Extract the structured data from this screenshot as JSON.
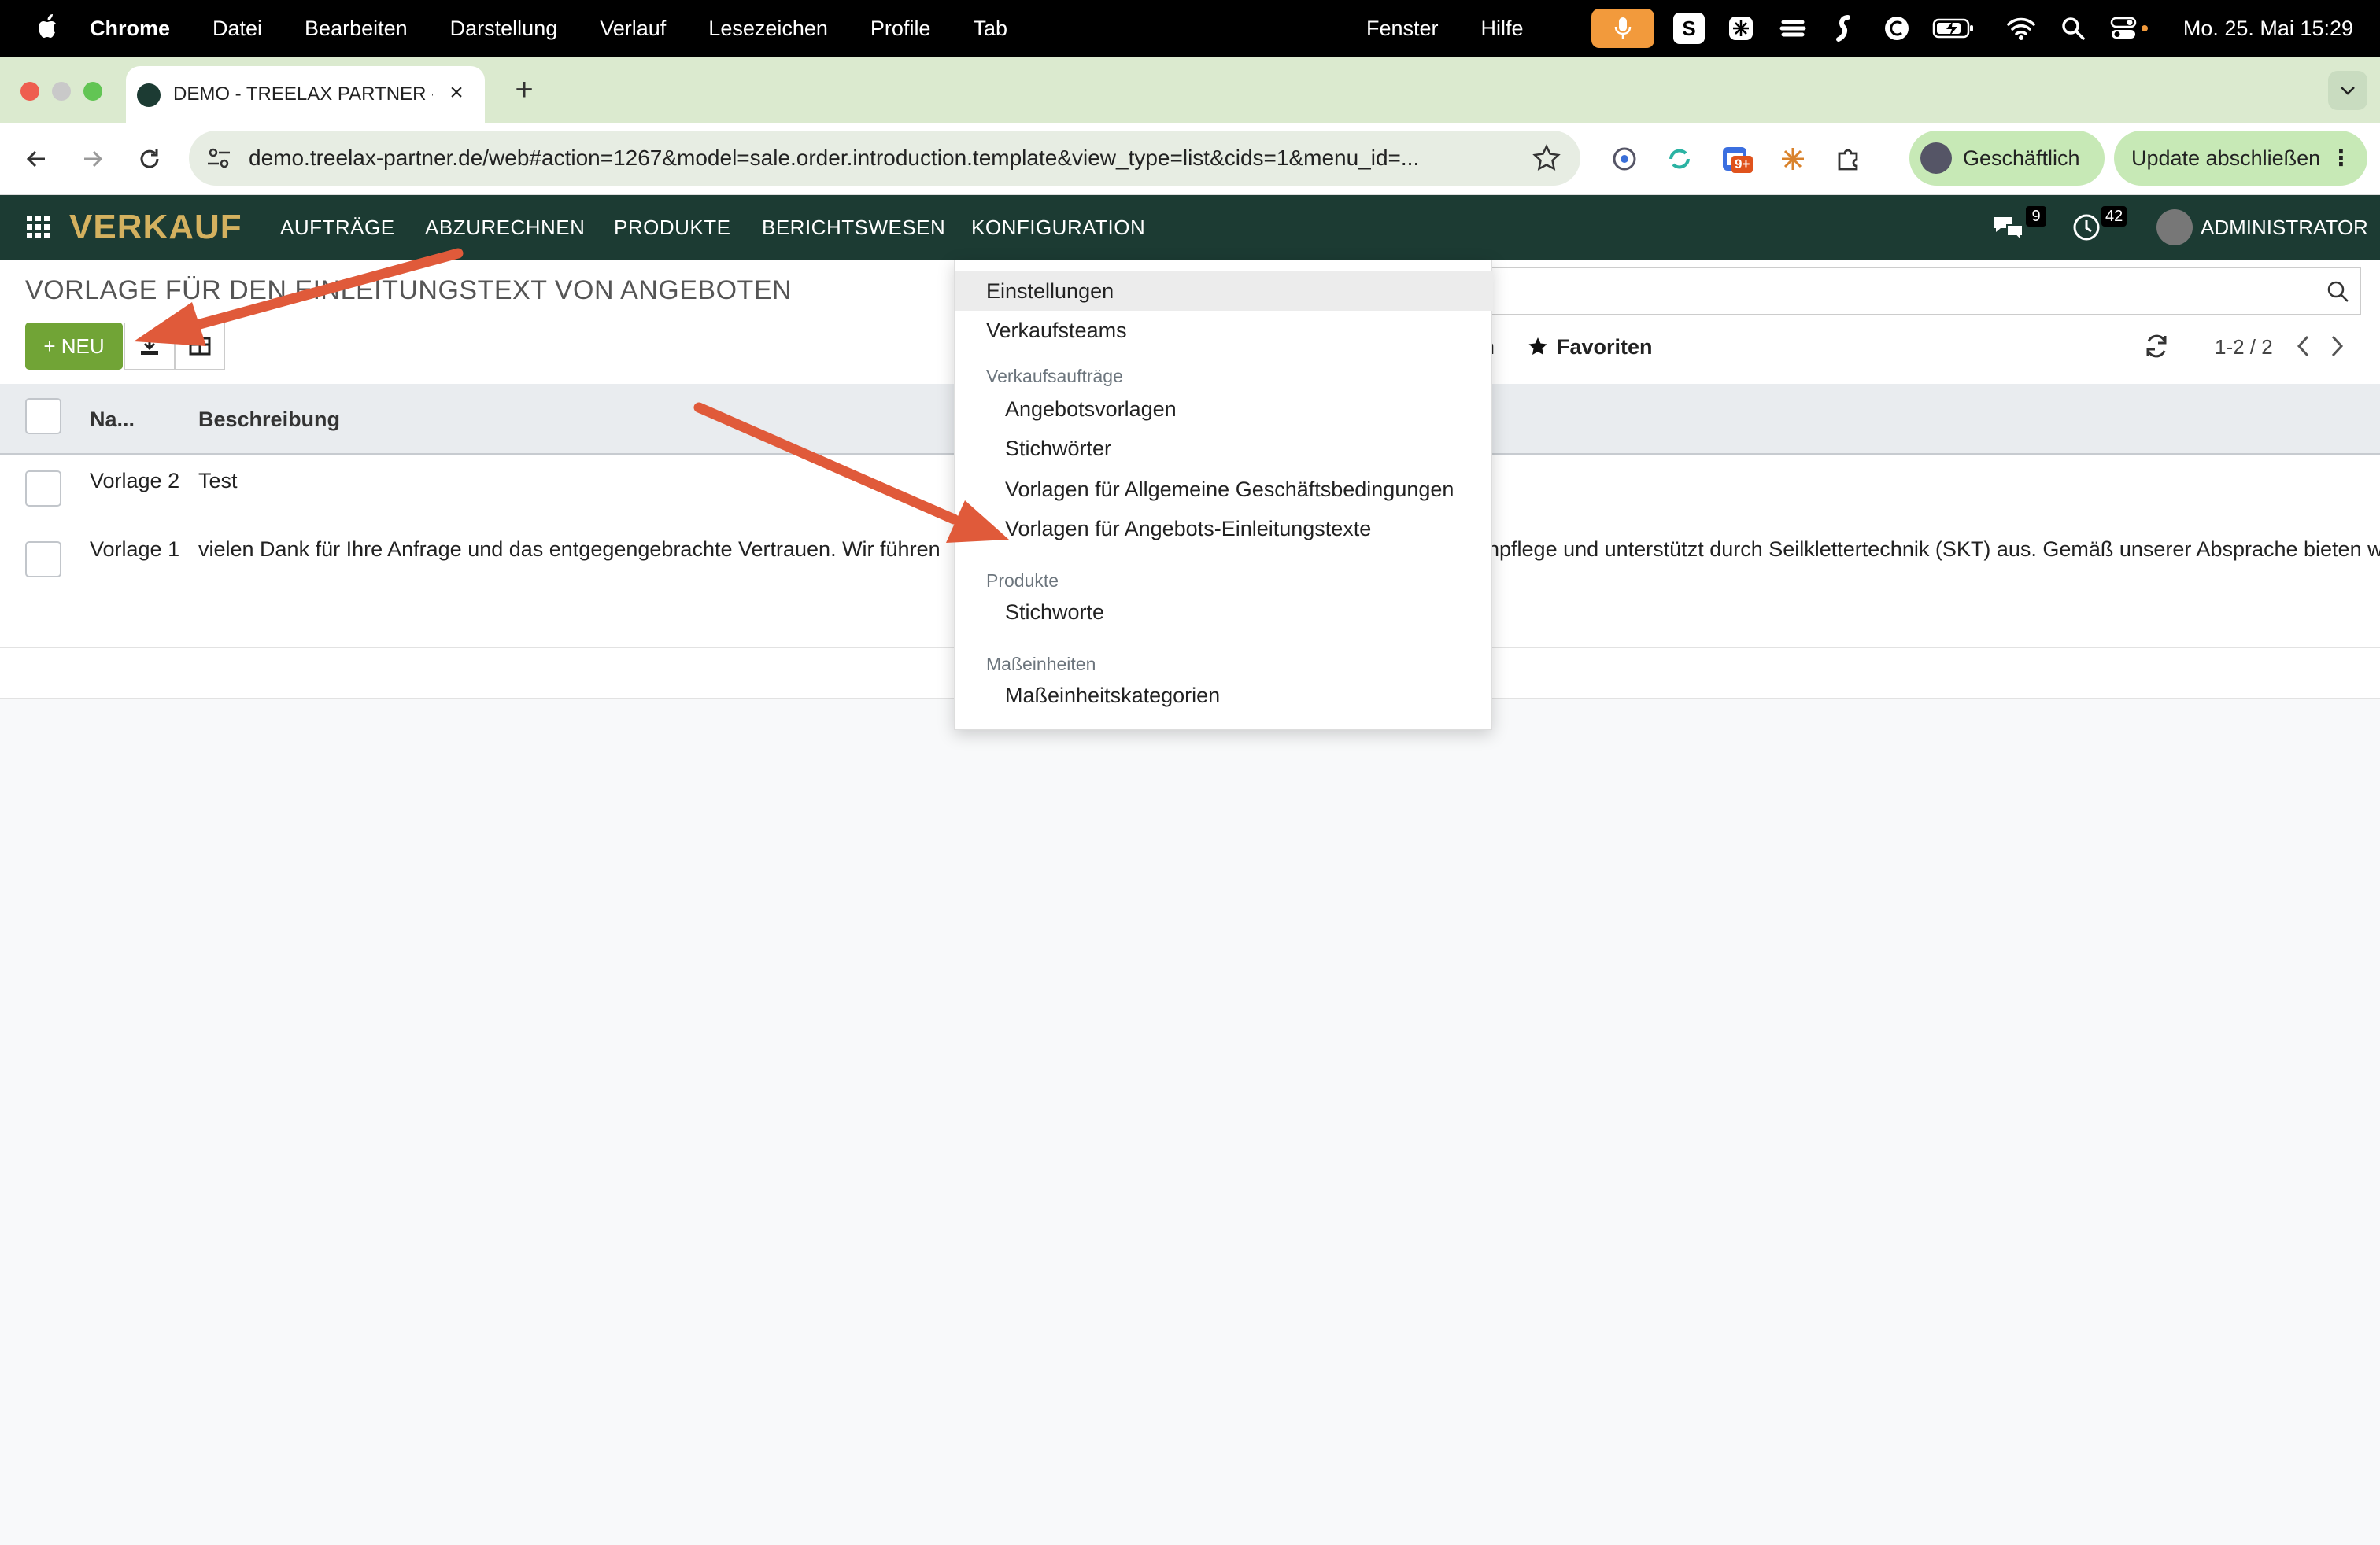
{
  "macos": {
    "app_name": "Chrome",
    "menus": [
      "Datei",
      "Bearbeiten",
      "Darstellung",
      "Verlauf",
      "Lesezeichen",
      "Profile",
      "Tab"
    ],
    "menus_right": [
      "Fenster",
      "Hilfe"
    ],
    "status_icons": [
      "microphone-icon",
      "s-app-icon",
      "perplexity-icon",
      "stacks-icon",
      "flow-icon",
      "c-circle-icon",
      "battery-icon",
      "wifi-icon",
      "spotlight-icon",
      "control-center-icon"
    ],
    "s_label": "S",
    "clock": "Mo. 25. Mai  15:29"
  },
  "browser": {
    "tab_title": "DEMO - TREELAX PARTNER -",
    "url": "demo.treelax-partner.de/web#action=1267&model=sale.order.introduction.template&view_type=list&cids=1&menu_id=...",
    "extension_badge": "9+",
    "profile_label": "Geschäftlich",
    "update_label": "Update abschließen",
    "update_more": "⋮"
  },
  "odoo_nav": {
    "brand": "VERKAUF",
    "items": [
      "AUFTRÄGE",
      "ABZURECHNEN",
      "PRODUKTE",
      "BERICHTSWESEN",
      "KONFIGURATION"
    ],
    "messages_count": "9",
    "activities_count": "42",
    "user": "ADMINISTRATOR"
  },
  "control_panel": {
    "title": "VORLAGE FÜR DEN EINLEITUNGSTEXT VON ANGEBOTEN",
    "new_button": "+ NEU",
    "partial_label": "n",
    "favorites": "Favoriten",
    "pager": "1-2 / 2"
  },
  "table": {
    "headers": [
      "Na...",
      "Beschreibung"
    ],
    "rows": [
      {
        "name": "Vorlage 2",
        "description_left": "Test",
        "description_right": ""
      },
      {
        "name": "Vorlage 1",
        "description_left": "vielen Dank für Ihre Anfrage und das entgegengebrachte Vertrauen. Wir führen",
        "description_right": "npflege und unterstützt durch Seilklettertechnik (SKT) aus. Gemäß unserer Absprache bieten w"
      }
    ]
  },
  "dropdown": {
    "top_items": [
      "Einstellungen",
      "Verkaufsteams"
    ],
    "sections": [
      {
        "header": "Verkaufsaufträge",
        "items": [
          "Angebotsvorlagen",
          "Stichwörter",
          "Vorlagen für Allgemeine Geschäftsbedingungen",
          "Vorlagen für Angebots-Einleitungstexte"
        ]
      },
      {
        "header": "Produkte",
        "items": [
          "Stichworte"
        ]
      },
      {
        "header": "Maßeinheiten",
        "items": [
          "Maßeinheitskategorien"
        ]
      }
    ]
  },
  "colors": {
    "odoo_nav_bg": "#1c3b33",
    "brand": "#d4b15f",
    "new_button": "#71a436",
    "annotation_arrow": "#e05a3a",
    "chrome_frame": "#dbeacf"
  }
}
